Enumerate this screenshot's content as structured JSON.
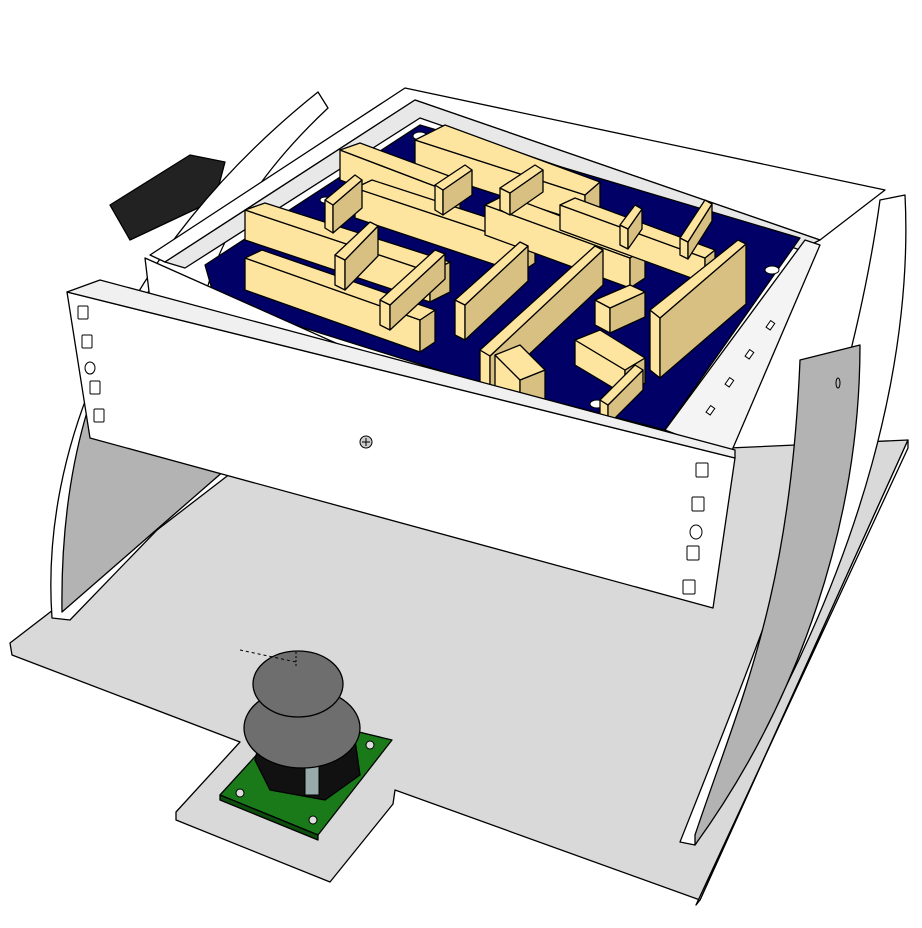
{
  "scene": {
    "colors": {
      "background": "#ffffff",
      "base_plate": "#d9d9d9",
      "side_panel_face": "#b3b3b3",
      "panel_white": "#ffffff",
      "maze_floor": "#000066",
      "maze_wall_top": "#fde5a0",
      "maze_wall_side": "#d8c082",
      "pcb": "#1a7a1a",
      "joystick_knob": "#6e6e6e",
      "joystick_body": "#111111",
      "servo": "#222222"
    },
    "icons": [
      "screw-icon",
      "mounting-slot-icon"
    ]
  }
}
